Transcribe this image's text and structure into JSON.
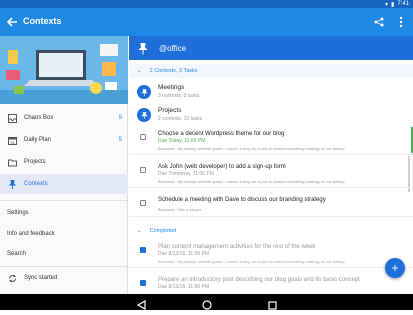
{
  "status": {
    "time": "7:41"
  },
  "appbar": {
    "title": "Contexts"
  },
  "drawer": {
    "items": [
      {
        "label": "Chaos Box",
        "count": "9"
      },
      {
        "label": "Daily Plan",
        "count": "5"
      },
      {
        "label": "Projects",
        "count": ""
      },
      {
        "label": "Contexts",
        "count": ""
      }
    ],
    "settings": "Settings",
    "info": "Info and feedback",
    "search": "Search",
    "sync": "Sync started"
  },
  "context": {
    "name": "@office",
    "group_label": "2 Contexts, 3 Tasks",
    "projects": [
      {
        "title": "Meetings",
        "subtitle": "3 contexts, 9 tasks"
      },
      {
        "title": "Projects",
        "subtitle": "2 contexts, 10 tasks"
      }
    ],
    "tasks": [
      {
        "title": "Choose a decent Wordpress theme for our blog",
        "due": "Due Today, 11:00 PM",
        "path": "Business › My startup website goals › Launch a blog as a part of content marketing strategy of our startup"
      },
      {
        "title": "Ask John (web developer) to add a sign-up form",
        "due": "Due Tomorrow, 11:00 PM",
        "path": "Business › My startup website goals › Launch a blog as a part of content marketing strategy of our startup"
      },
      {
        "title": "Schedule a meeting with Dave to discuss our branding strategy",
        "due": "",
        "path": "Business › Hire a lawyer"
      }
    ],
    "completed_label": "Completed",
    "completed": [
      {
        "title": "Plan content management activities for the rest of the week",
        "due": "Due 8/12/16, 11:00 PM",
        "path": "Business › My startup website goals › Launch a blog as a part of content marketing strategy of our startup"
      },
      {
        "title": "Prepare an introductory post describing our blog goals and its basic concept",
        "due": "Due 8/13/16, 11:00 PM",
        "path": ""
      }
    ]
  },
  "colors": {
    "primary": "#1e88e5",
    "header": "#1e6fd9",
    "due_today": "#4caf50"
  }
}
